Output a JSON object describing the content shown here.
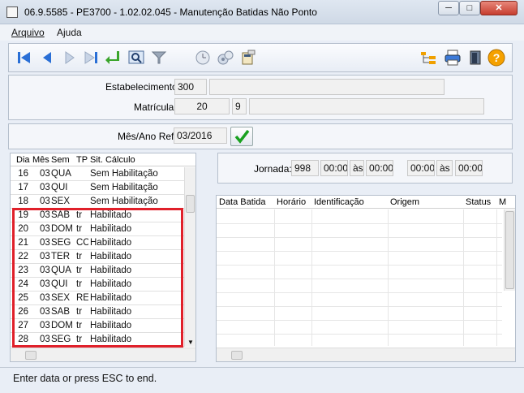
{
  "window": {
    "title": "06.9.5585 - PE3700 - 1.02.02.045 - Manutenção Batidas Não Ponto",
    "minimize": "─",
    "maximize": "□",
    "close": "✕"
  },
  "menu": {
    "arquivo": "Arquivo",
    "ajuda": "Ajuda"
  },
  "toolbar": {
    "icons": [
      "first-icon",
      "prev-icon",
      "next-icon",
      "last-icon",
      "goto-icon",
      "search-icon",
      "filter-icon",
      "clock-icon",
      "settings-icon",
      "calculator-icon",
      "tree-icon",
      "print-icon",
      "exit-icon",
      "help-icon"
    ],
    "help_label": "?"
  },
  "form": {
    "estabelecimento_label": "Estabelecimento:",
    "estabelecimento_value": "300",
    "estabelecimento_desc": "",
    "matricula_label": "Matrícula:",
    "matricula_value": "20",
    "matricula_digit": "9",
    "matricula_name": "",
    "mesano_label": "Mês/Ano Ref:",
    "mesano_value": "03/2016"
  },
  "days_table": {
    "headers": {
      "dia": "Dia",
      "mes": "Mês",
      "sem": "Sem",
      "tp": "TP",
      "sit": "Sit. Cálculo"
    },
    "rows": [
      {
        "dia": "16",
        "mes": "03",
        "sem": "QUA",
        "tp": "",
        "sit": "Sem Habilitação"
      },
      {
        "dia": "17",
        "mes": "03",
        "sem": "QUI",
        "tp": "",
        "sit": "Sem Habilitação"
      },
      {
        "dia": "18",
        "mes": "03",
        "sem": "SEX",
        "tp": "",
        "sit": "Sem Habilitação"
      },
      {
        "dia": "19",
        "mes": "03",
        "sem": "SAB",
        "tp": "tr",
        "sit": "Habilitado"
      },
      {
        "dia": "20",
        "mes": "03",
        "sem": "DOM",
        "tp": "tr",
        "sit": "Habilitado"
      },
      {
        "dia": "21",
        "mes": "03",
        "sem": "SEG",
        "tp": "CC",
        "sit": "Habilitado"
      },
      {
        "dia": "22",
        "mes": "03",
        "sem": "TER",
        "tp": "tr",
        "sit": "Habilitado"
      },
      {
        "dia": "23",
        "mes": "03",
        "sem": "QUA",
        "tp": "tr",
        "sit": "Habilitado"
      },
      {
        "dia": "24",
        "mes": "03",
        "sem": "QUI",
        "tp": "tr",
        "sit": "Habilitado"
      },
      {
        "dia": "25",
        "mes": "03",
        "sem": "SEX",
        "tp": "RE",
        "sit": "Habilitado"
      },
      {
        "dia": "26",
        "mes": "03",
        "sem": "SAB",
        "tp": "tr",
        "sit": "Habilitado"
      },
      {
        "dia": "27",
        "mes": "03",
        "sem": "DOM",
        "tp": "tr",
        "sit": "Habilitado"
      },
      {
        "dia": "28",
        "mes": "03",
        "sem": "SEG",
        "tp": "tr",
        "sit": "Habilitado"
      }
    ]
  },
  "jornada": {
    "label": "Jornada:",
    "code": "998",
    "t1": "00:00",
    "as1": "às",
    "t2": "00:00",
    "t3": "00:00",
    "as2": "às",
    "t4": "00:00"
  },
  "batidas_table": {
    "headers": {
      "data": "Data Batida",
      "horario": "Horário",
      "ident": "Identificação",
      "origem": "Origem",
      "status": "Status",
      "m": "M"
    }
  },
  "statusbar": {
    "text": "Enter data or press ESC to end."
  },
  "colors": {
    "highlight": "#e0202a",
    "accent": "#2a6fd6"
  }
}
